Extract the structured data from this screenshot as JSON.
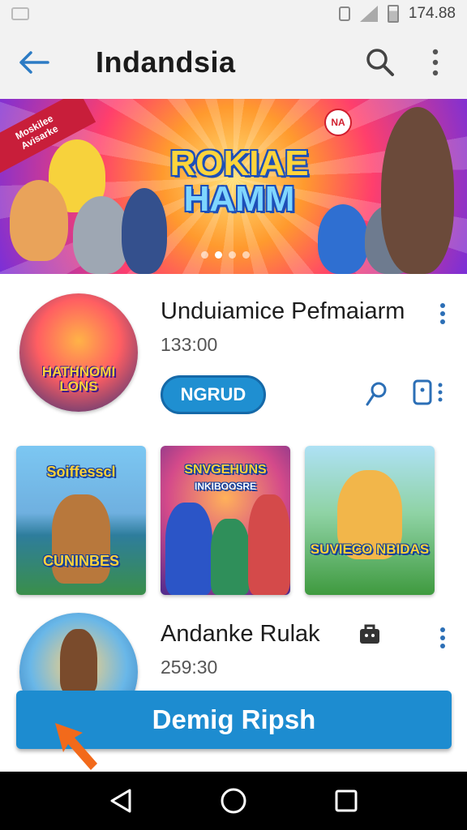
{
  "status_bar": {
    "time": "174.88"
  },
  "app_bar": {
    "title": "Indandsia"
  },
  "banner": {
    "ribbon_line1": "Moskilee",
    "ribbon_line2": "Avisarke",
    "title_line1": "ROKIAE",
    "title_line2": "HAMM",
    "logo_text": "NA"
  },
  "item1": {
    "title": "Unduiamice Pefmaiarm",
    "subtitle": "133:00",
    "button_label": "NGRUD",
    "avatar_caption_line1": "HATHNOMI",
    "avatar_caption_line2": "LONS"
  },
  "thumbnails": [
    {
      "caption_top": "Soiffesscl",
      "caption_bottom": "CUNINBES"
    },
    {
      "caption_top": "SNVGEHUNS",
      "caption_sub": "INKIBOOSRE",
      "caption_bottom": ""
    },
    {
      "caption_top": "",
      "caption_bottom": "SUVIECO NBIDAS"
    }
  ],
  "item2": {
    "title": "Andanke Rulak",
    "subtitle": "259:30"
  },
  "cta": {
    "label": "Demig Ripsh"
  },
  "colors": {
    "accent": "#1d8cd0",
    "icon_blue": "#2c6fb6"
  },
  "icons": [
    "back-arrow-icon",
    "search-icon",
    "more-vert-icon",
    "pin-icon",
    "device-icon",
    "briefcase-icon",
    "back-nav-icon",
    "home-nav-icon",
    "recents-nav-icon"
  ]
}
